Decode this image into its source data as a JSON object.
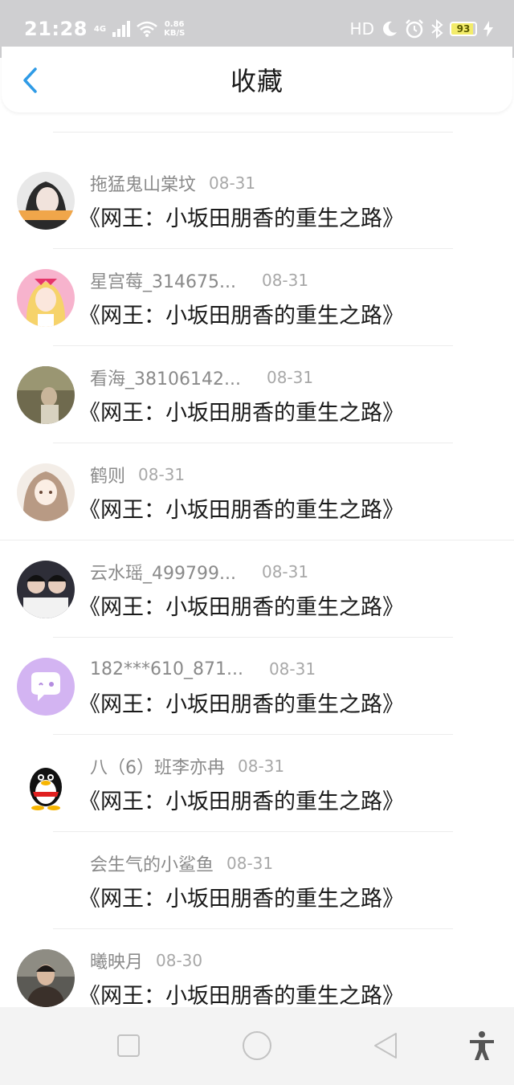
{
  "status_bar": {
    "time": "21:28",
    "network_type": "4G",
    "speed_value": "0.86",
    "speed_unit": "KB/S",
    "hd_label": "HD",
    "battery_level": "93"
  },
  "header": {
    "title": "收藏"
  },
  "items": [
    {
      "username": "拖猛鬼山棠坟",
      "date": "08-31",
      "book": "《网王：小坂田朋香的重生之路》"
    },
    {
      "username": "星宫莓_314675...",
      "date": "08-31",
      "book": "《网王：小坂田朋香的重生之路》"
    },
    {
      "username": "看海_38106142...",
      "date": "08-31",
      "book": "《网王：小坂田朋香的重生之路》"
    },
    {
      "username": "鹤则",
      "date": "08-31",
      "book": "《网王：小坂田朋香的重生之路》"
    },
    {
      "username": "云水瑶_499799...",
      "date": "08-31",
      "book": "《网王：小坂田朋香的重生之路》"
    },
    {
      "username": "182***610_871...",
      "date": "08-31",
      "book": "《网王：小坂田朋香的重生之路》"
    },
    {
      "username": "八（6）班李亦冉",
      "date": "08-31",
      "book": "《网王：小坂田朋香的重生之路》"
    },
    {
      "username": "会生气的小鲨鱼",
      "date": "08-31",
      "book": "《网王：小坂田朋香的重生之路》"
    },
    {
      "username": "曦映月",
      "date": "08-30",
      "book": "《网王：小坂田朋香的重生之路》"
    }
  ],
  "avatars": [
    {
      "icon": "avatar-girl-photo",
      "color": "#6b6b6b"
    },
    {
      "icon": "avatar-anime-pink",
      "color": "#f5a8c8"
    },
    {
      "icon": "avatar-outdoor-photo",
      "color": "#8c8466"
    },
    {
      "icon": "avatar-anime-girl",
      "color": "#d9c7b8"
    },
    {
      "icon": "avatar-duo-photo",
      "color": "#3a3a48"
    },
    {
      "icon": "avatar-chat-bubble",
      "color": "#d3b4f2"
    },
    {
      "icon": "avatar-qq-penguin",
      "color": "#ffffff"
    },
    {
      "icon": "avatar-none",
      "color": "#ffffff"
    },
    {
      "icon": "avatar-boy-photo",
      "color": "#4a4038"
    }
  ],
  "colors": {
    "accent": "#2f9be6",
    "status_bar_bg": "#cfcfd1",
    "nav_bar_bg": "#f3f3f3"
  }
}
